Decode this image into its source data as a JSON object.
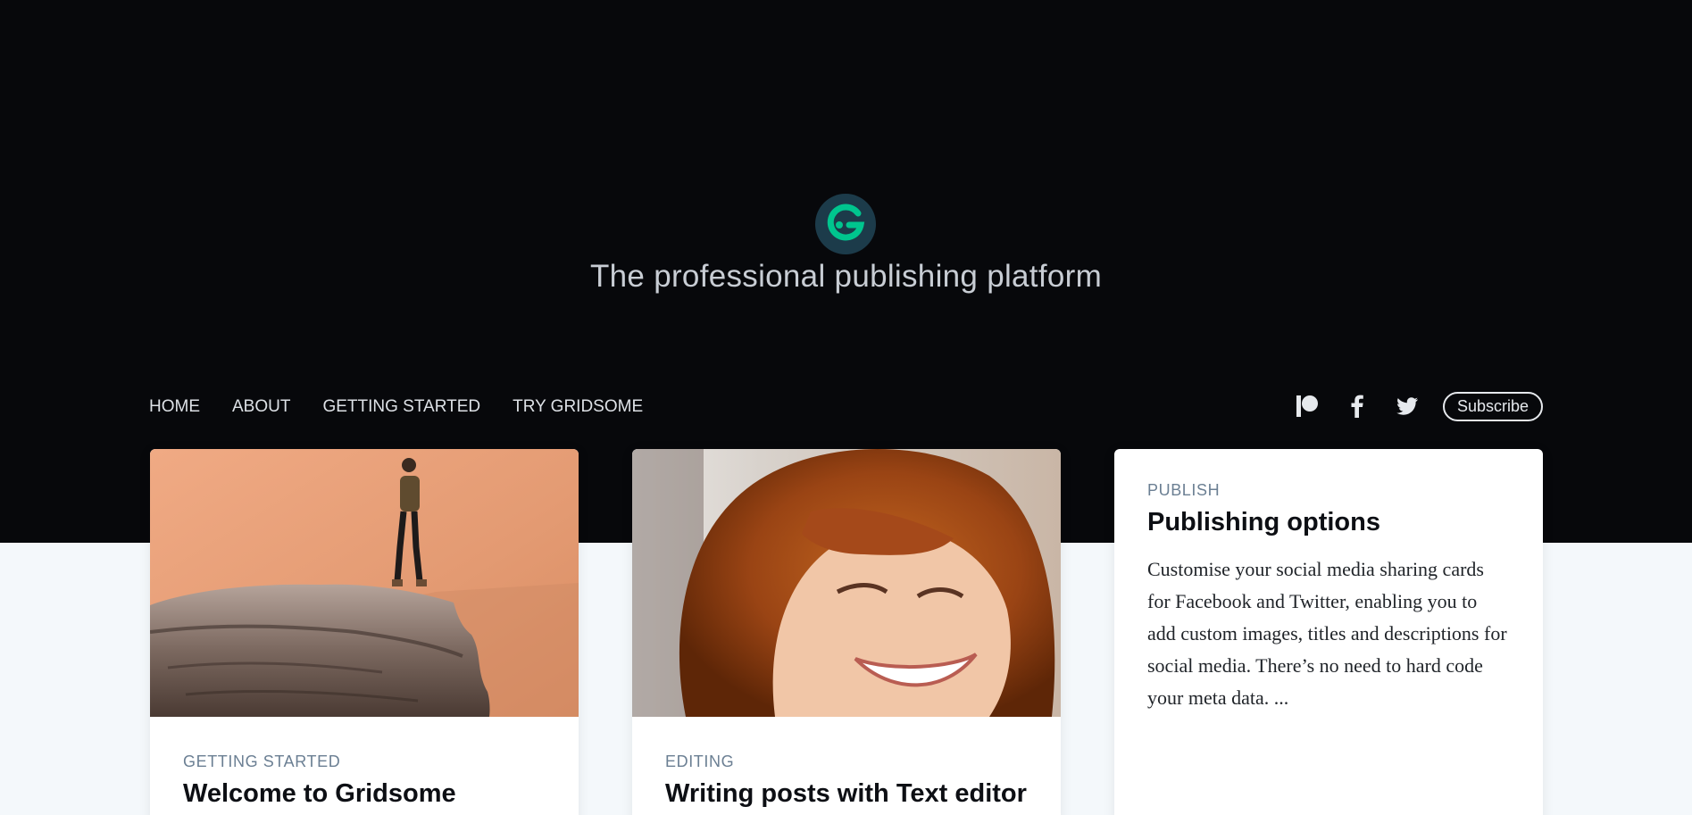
{
  "site": {
    "tagline": "The professional publishing platform",
    "logo_icon": "gridsome-logo-icon",
    "accent_color": "#00a672",
    "hero_background": "#07080b"
  },
  "nav": {
    "links": [
      "HOME",
      "ABOUT",
      "GETTING STARTED",
      "TRY GRIDSOME"
    ]
  },
  "social": {
    "icons": [
      "patreon-icon",
      "facebook-icon",
      "twitter-icon"
    ],
    "subscribe_label": "Subscribe"
  },
  "posts": [
    {
      "tag": "GETTING STARTED",
      "title": "Welcome to Gridsome",
      "image": "person-on-cliff-photo"
    },
    {
      "tag": "EDITING",
      "title": "Writing posts with Text editor",
      "image": "smiling-woman-photo"
    },
    {
      "tag": "PUBLISH",
      "title": "Publishing options",
      "excerpt": "Customise your social media sharing cards for Facebook and Twitter, enabling you to add custom images, titles and descriptions for social media. There’s no need to hard code your meta data. ..."
    }
  ]
}
